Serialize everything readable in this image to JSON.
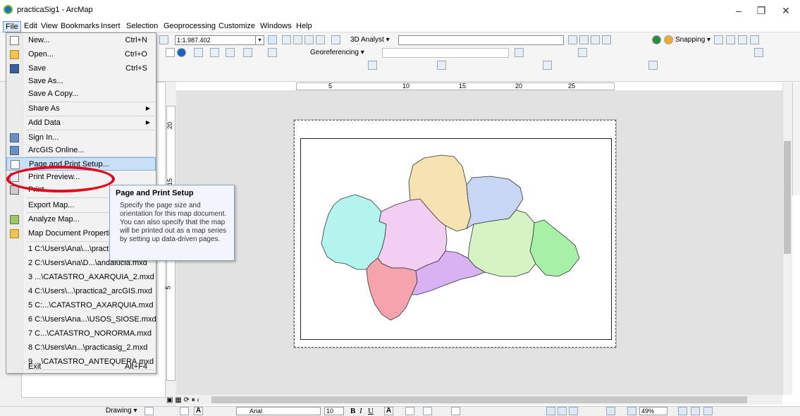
{
  "window": {
    "title": "practicaSig1 - ArcMap",
    "minimize": "–",
    "maximize": "❐",
    "close": "✕"
  },
  "menubar": {
    "items": [
      "File",
      "Edit",
      "View",
      "Bookmarks",
      "Insert",
      "Selection",
      "Geoprocessing",
      "Customize",
      "Windows",
      "Help"
    ]
  },
  "toolbar": {
    "scale": "1:1.987.402",
    "analyst_label": "3D Analyst ▾",
    "georef_label": "Georeferencing ▾",
    "snapping_label": "Snapping ▾"
  },
  "file_menu": {
    "items": [
      {
        "label": "New...",
        "shortcut": "Ctrl+N",
        "icon": "new-document-icon"
      },
      {
        "label": "Open...",
        "shortcut": "Ctrl+O",
        "icon": "open-folder-icon"
      },
      {
        "label": "Save",
        "shortcut": "Ctrl+S",
        "icon": "save-disk-icon"
      },
      {
        "label": "Save As...",
        "shortcut": ""
      },
      {
        "label": "Save A Copy...",
        "shortcut": ""
      },
      {
        "label": "Share As",
        "shortcut": "",
        "submenu": true
      },
      {
        "label": "Add Data",
        "shortcut": "",
        "submenu": true
      },
      {
        "label": "Sign In...",
        "shortcut": "",
        "icon": "sign-in-icon"
      },
      {
        "label": "ArcGIS Online...",
        "shortcut": "",
        "icon": "arcgis-online-icon"
      },
      {
        "label": "Page and Print Setup...",
        "shortcut": "",
        "icon": "page-setup-icon"
      },
      {
        "label": "Print Preview...",
        "shortcut": "",
        "icon": "print-preview-icon"
      },
      {
        "label": "Print...",
        "shortcut": "",
        "icon": "printer-icon"
      },
      {
        "label": "Export Map...",
        "shortcut": ""
      },
      {
        "label": "Analyze Map...",
        "shortcut": "",
        "icon": "analyze-map-icon"
      },
      {
        "label": "Map Document Properties...",
        "shortcut": "",
        "icon": "properties-icon"
      },
      {
        "label": "1 C:\\Users\\Ana\\...\\practicaSig1.mxd",
        "shortcut": ""
      },
      {
        "label": "2 C:\\Users\\Ana\\D...\\andalucia.mxd",
        "shortcut": ""
      },
      {
        "label": "3 ...\\CATASTRO_AXARQUIA_2.mxd",
        "shortcut": ""
      },
      {
        "label": "4 C:\\Users\\...\\practica2_arcGIS.mxd",
        "shortcut": ""
      },
      {
        "label": "5 C:...\\CATASTRO_AXARQUIA.mxd",
        "shortcut": ""
      },
      {
        "label": "6 C:\\Users\\Ana...\\USOS_SIOSE.mxd",
        "shortcut": ""
      },
      {
        "label": "7 C...\\CATASTRO_NORORMA.mxd",
        "shortcut": ""
      },
      {
        "label": "8 C:\\Users\\An...\\practicasig_2.mxd",
        "shortcut": ""
      },
      {
        "label": "9 ...\\CATASTRO_ANTEQUERA.mxd",
        "shortcut": ""
      },
      {
        "label": "Exit",
        "shortcut": "Alt+F4"
      }
    ]
  },
  "tooltip": {
    "title": "Page and Print Setup",
    "body": "Specify the page size and orientation for this map document. You can also specify that the map will be printed out as a map series by setting up data-driven pages."
  },
  "rulers": {
    "horizontal": [
      "5",
      "10",
      "15",
      "20",
      "25"
    ],
    "vertical": [
      "20",
      "15",
      "5"
    ]
  },
  "bottom_toolbar": {
    "drawing_label": "Drawing ▾",
    "font": "Arial",
    "font_size": "10",
    "bold": "B",
    "italic": "I",
    "underline": "U",
    "zoom": "49%"
  },
  "map": {
    "province_colors": [
      "#b3f5ee",
      "#f2cff2",
      "#f7e2b2",
      "#c6d6f3",
      "#d5f3c3",
      "#f5a3ad",
      "#d8b2f2",
      "#a7f0a7"
    ]
  }
}
